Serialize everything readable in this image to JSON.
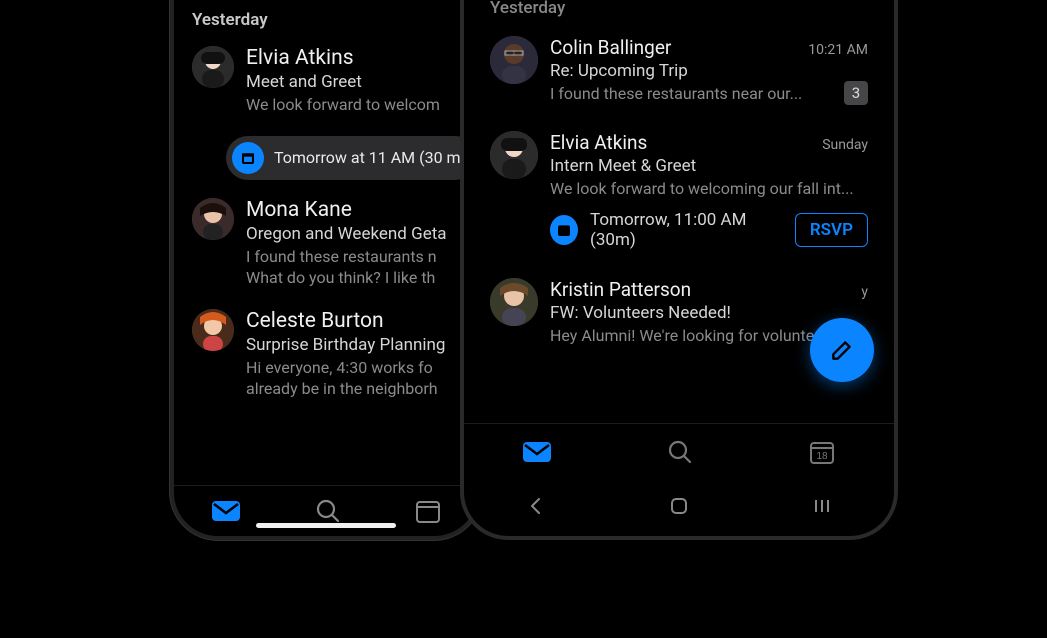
{
  "phoneA": {
    "sectionHeader": "Yesterday",
    "messages": [
      {
        "sender": "Elvia Atkins",
        "subject": "Meet and Greet",
        "preview": "We look forward to welcom",
        "event": {
          "text": "Tomorrow at 11 AM (30 m"
        }
      },
      {
        "sender": "Mona Kane",
        "subject": "Oregon and Weekend Geta",
        "preview": "I found these restaurants n\nWhat do you think? I like th"
      },
      {
        "sender": "Celeste Burton",
        "subject": "Surprise Birthday Planning",
        "preview": "Hi everyone, 4:30 works fo\nalready be in the neighborh"
      }
    ]
  },
  "phoneB": {
    "sectionHeader": "Yesterday",
    "messages": [
      {
        "sender": "Colin Ballinger",
        "time": "10:21 AM",
        "subject": "Re: Upcoming Trip",
        "preview": "I found these restaurants near our...",
        "badge": "3"
      },
      {
        "sender": "Elvia Atkins",
        "time": "Sunday",
        "subject": "Intern Meet & Greet",
        "preview": "We look forward to welcoming our fall int...",
        "event": {
          "text": "Tomorrow, 11:00 AM (30m)",
          "rsvp": "RSVP"
        }
      },
      {
        "sender": "Kristin Patterson",
        "time": "y",
        "subject": "FW: Volunteers Needed!",
        "preview": "Hey Alumni! We're looking for voluntee"
      }
    ],
    "calendarDay": "18"
  }
}
